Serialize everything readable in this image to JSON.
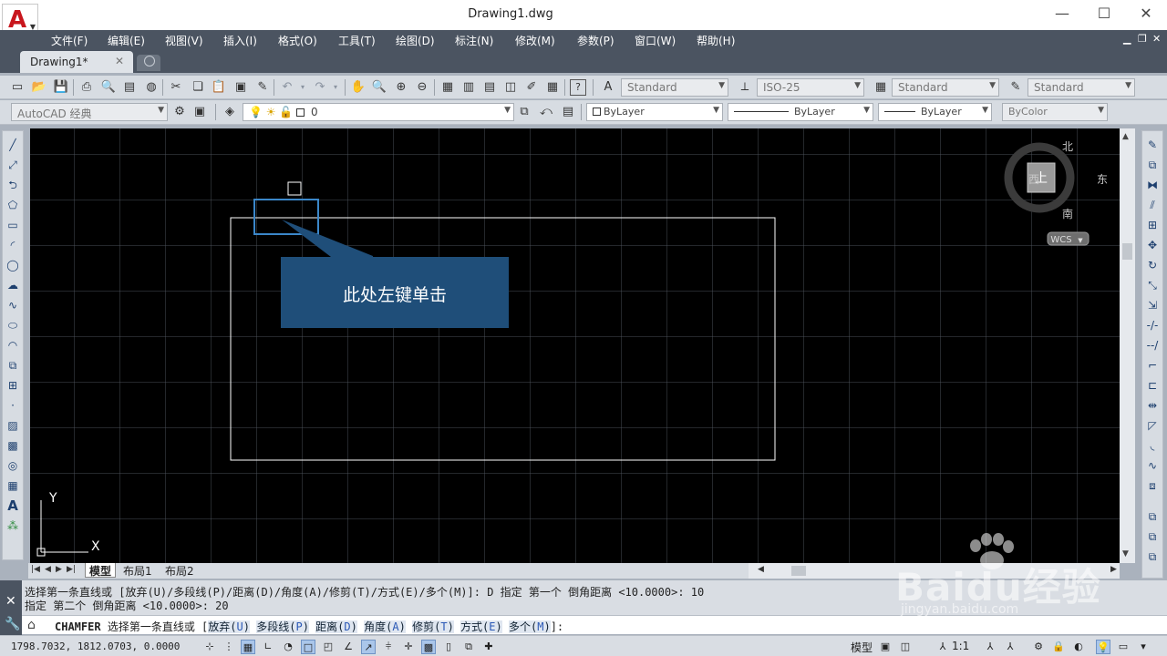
{
  "title": "Drawing1.dwg",
  "window_controls": {
    "minimize": "—",
    "maximize": "☐",
    "close": "✕"
  },
  "menu": [
    "文件(F)",
    "编辑(E)",
    "视图(V)",
    "插入(I)",
    "格式(O)",
    "工具(T)",
    "绘图(D)",
    "标注(N)",
    "修改(M)",
    "参数(P)",
    "窗口(W)",
    "帮助(H)"
  ],
  "document_tab": {
    "label": "Drawing1*",
    "close": "✕"
  },
  "styles": {
    "text_style": "Standard",
    "dim_style": "ISO-25",
    "table_style": "Standard",
    "mleader_style": "Standard"
  },
  "workspace": "AutoCAD 经典",
  "layer": {
    "current": "0"
  },
  "properties": {
    "color": "ByLayer",
    "linetype": "ByLayer",
    "lineweight": "ByLayer",
    "plotstyle": "ByColor"
  },
  "viewcube": {
    "north": "北",
    "south": "南",
    "east": "东",
    "west": "西",
    "top": "上",
    "wcs": "WCS"
  },
  "ucs": {
    "y": "Y",
    "x": "X"
  },
  "annotation": {
    "text": "此处左键单击"
  },
  "layout_tabs": [
    "模型",
    "布局1",
    "布局2"
  ],
  "command_history": [
    "选择第一条直线或 [放弃(U)/多段线(P)/距离(D)/角度(A)/修剪(T)/方式(E)/多个(M)]: D 指定 第一个 倒角距离 <10.0000>: 10",
    "指定 第二个 倒角距离 <10.0000>: 20"
  ],
  "command_prompt": {
    "command": "CHAMFER",
    "text": "选择第一条直线或 [",
    "options": [
      {
        "label": "放弃",
        "key": "U"
      },
      {
        "label": "多段线",
        "key": "P"
      },
      {
        "label": "距离",
        "key": "D"
      },
      {
        "label": "角度",
        "key": "A"
      },
      {
        "label": "修剪",
        "key": "T"
      },
      {
        "label": "方式",
        "key": "E"
      },
      {
        "label": "多个",
        "key": "M"
      }
    ],
    "suffix": "]:"
  },
  "status": {
    "coords": "1798.7032, 1812.0703, 0.0000",
    "model": "模型",
    "scale": "1:1"
  },
  "watermark": {
    "brand": "Baidu经验",
    "url": "jingyan.baidu.com"
  }
}
